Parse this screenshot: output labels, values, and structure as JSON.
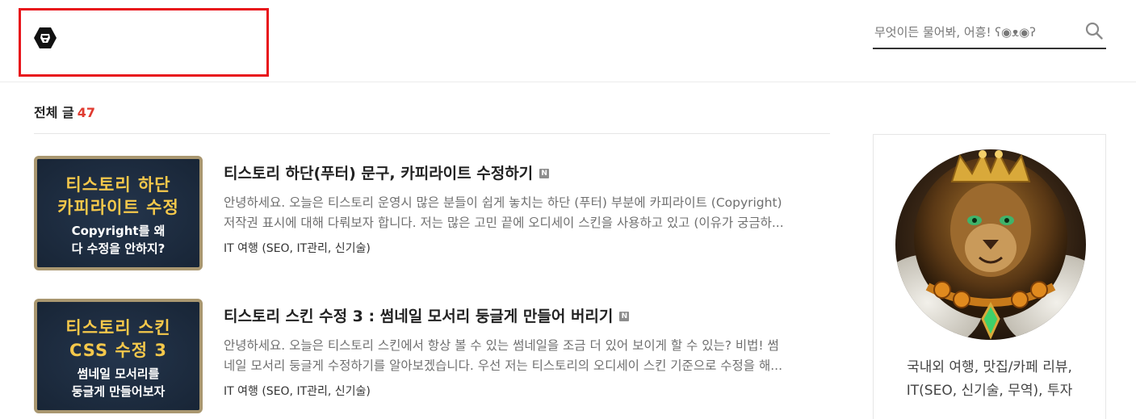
{
  "header": {
    "logo_icon": "lion-logo-icon",
    "search": {
      "placeholder": "무엇이든 물어봐, 어흥! ʕ◉ᴥ◉ʔ",
      "icon": "search-icon"
    }
  },
  "section": {
    "title": "전체 글",
    "count": "47"
  },
  "posts": [
    {
      "thumb_line1": "티스토리 하단",
      "thumb_line2": "카피라이트 수정",
      "thumb_line3": "Copyright를 왜",
      "thumb_line4": "다 수정을 안하지?",
      "title": "티스토리 하단(푸터) 문구, 카피라이트 수정하기",
      "badge": "N",
      "excerpt_line1": "안녕하세요. 오늘은 티스토리 운영시 많은 분들이 쉽게 놓치는 하단 (푸터) 부분에 카피라이트 (Copyright)",
      "excerpt_line2": "저작권 표시에 대해 다뤄보자 합니다. 저는 많은 고민 끝에 오디세이 스킨을 사용하고 있고 (이유가 궁금하...",
      "category": "IT 여행 (SEO, IT관리, 신기술)"
    },
    {
      "thumb_line1": "티스토리 스킨",
      "thumb_line2": "CSS 수정 3",
      "thumb_line3": "썸네일 모서리를",
      "thumb_line4": "둥글게 만들어보자",
      "title": "티스토리 스킨 수정 3 : 썸네일 모서리 둥글게 만들어 버리기",
      "badge": "N",
      "excerpt_line1": "안녕하세요. 오늘은 티스토리 스킨에서 항상 볼 수 있는 썸네일을 조금 더 있어 보이게 할 수 있는? 비법! 썸",
      "excerpt_line2": "네일 모서리 둥글게 수정하기를 알아보겠습니다. 우선 저는 티스토리의 오디세이 스킨 기준으로 수정을 해...",
      "category": "IT 여행 (SEO, IT관리, 신기술)"
    }
  ],
  "profile": {
    "avatar": "lion-king-avatar",
    "desc_line1": "국내외 여행, 맛집/카페 리뷰,",
    "desc_line2": "IT(SEO, 신기술, 무역), 투자"
  },
  "colors": {
    "accent_count": "#e03a2f",
    "logo_box_border": "#e8141b",
    "thumb_title": "#f5c84b"
  }
}
